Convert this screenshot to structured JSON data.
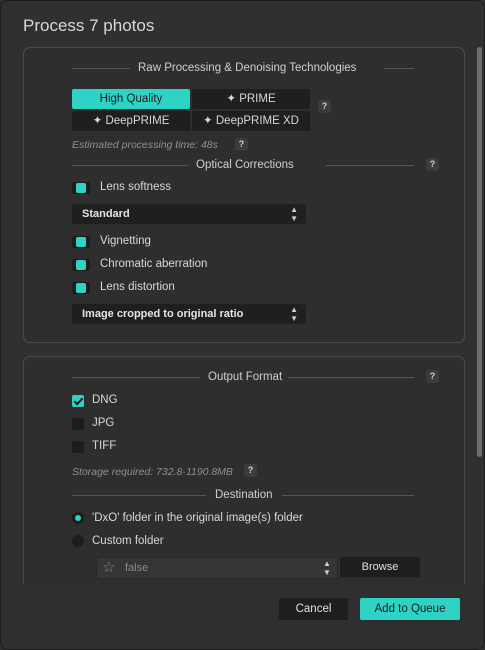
{
  "dialog": {
    "title": "Process 7 photos"
  },
  "raw": {
    "title": "Raw Processing & Denoising Technologies",
    "help": "?",
    "options": [
      {
        "label": "High Quality",
        "selected": true
      },
      {
        "label": "PRIME",
        "icon": "sparkle-icon",
        "selected": false
      },
      {
        "label": "DeepPRIME",
        "icon": "sparkle-icon",
        "selected": false
      },
      {
        "label": "DeepPRIME XD",
        "icon": "sparkle-icon",
        "selected": false
      }
    ],
    "estimate": "Estimated processing time:  48s",
    "estimate_help": "?"
  },
  "optical": {
    "title": "Optical Corrections",
    "help": "?",
    "lens_softness": {
      "label": "Lens softness",
      "on": true
    },
    "softness_select": "Standard",
    "vignetting": {
      "label": "Vignetting",
      "on": true
    },
    "chromatic": {
      "label": "Chromatic aberration",
      "on": true
    },
    "distortion": {
      "label": "Lens distortion",
      "on": true
    },
    "distortion_select": "Image cropped to original ratio"
  },
  "output": {
    "title": "Output Format",
    "help": "?",
    "formats": [
      {
        "label": "DNG",
        "checked": true
      },
      {
        "label": "JPG",
        "checked": false
      },
      {
        "label": "TIFF",
        "checked": false
      }
    ],
    "storage": "Storage required: 732.8-1190.8MB",
    "storage_help": "?"
  },
  "destination": {
    "title": "Destination",
    "options": [
      {
        "label": "'DxO' folder in the original image(s) folder",
        "selected": true
      },
      {
        "label": "Custom folder",
        "selected": false
      }
    ],
    "custom_path": "false",
    "browse_label": "Browse"
  },
  "footer": {
    "cancel_label": "Cancel",
    "add_label": "Add to Queue"
  },
  "colors": {
    "accent": "#2ed3c6",
    "background": "#303030"
  }
}
